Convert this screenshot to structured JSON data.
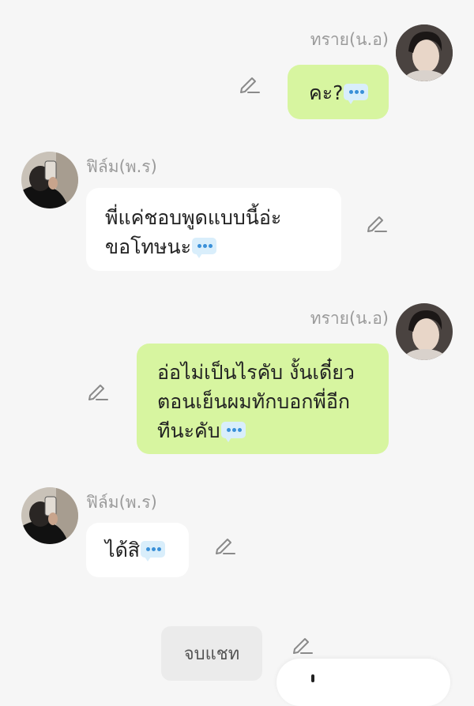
{
  "messages": [
    {
      "sender": "ทราย(น.อ)",
      "side": "right",
      "lines": [
        "คะ?"
      ]
    },
    {
      "sender": "ฟิล์ม(พ.ร)",
      "side": "left",
      "lines": [
        "พี่แค่ชอบพูดแบบนี้อ่ะ",
        "ขอโทษนะ"
      ]
    },
    {
      "sender": "ทราย(น.อ)",
      "side": "right",
      "lines": [
        "อ่อไม่เป็นไรคับ งั้นเดี๋ยว",
        "ตอนเย็นผมทักบอกพี่อีก",
        "ทีนะคับ"
      ]
    },
    {
      "sender": "ฟิล์ม(พ.ร)",
      "side": "left",
      "lines": [
        "ได้สิ"
      ]
    }
  ],
  "end_chat_label": "จบแชท",
  "icons": {
    "edit": "pencil-icon",
    "typing": "speech-ellipsis-icon"
  },
  "colors": {
    "background": "#f6f6f6",
    "own_bubble": "#d7f5a0",
    "other_bubble": "#ffffff",
    "name_text": "#9b9b9b"
  }
}
